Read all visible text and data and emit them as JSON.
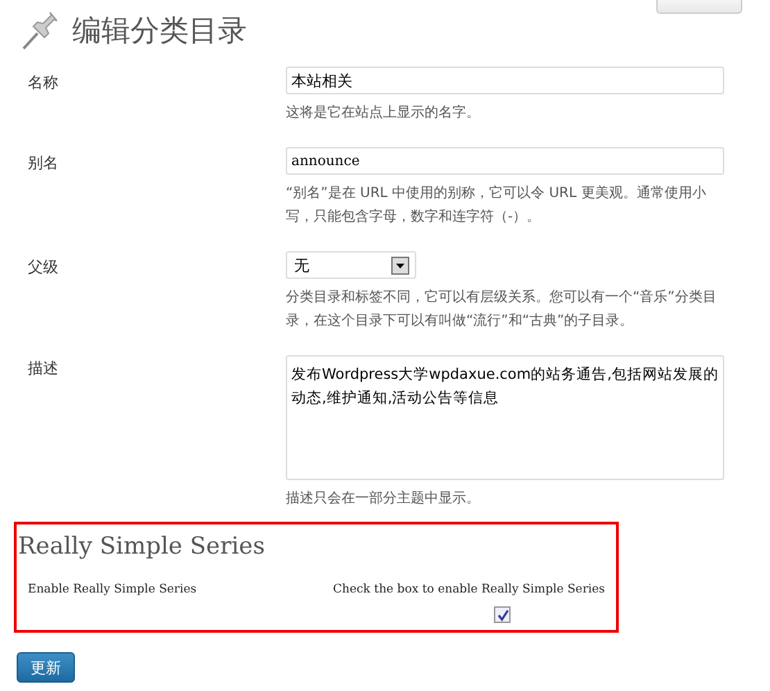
{
  "page_title": "编辑分类目录",
  "fields": [
    {
      "kind": "text",
      "label": "名称",
      "value": "本站相关",
      "hint": "这将是它在站点上显示的名字。"
    },
    {
      "kind": "slug",
      "label": "别名",
      "value": "announce",
      "hint": "“别名”是在 URL 中使用的别称，它可以令 URL 更美观。通常使用小写，只能包含字母，数字和连字符（-）。"
    },
    {
      "kind": "select",
      "label": "父级",
      "value": "无",
      "hint": "分类目录和标签不同，它可以有层级关系。您可以有一个“音乐”分类目录，在这个目录下可以有叫做“流行”和“古典”的子目录。"
    },
    {
      "kind": "textarea",
      "label": "描述",
      "value": "发布Wordpress大学wpdaxue.com的站务通告,包括网站发展的动态,维护通知,活动公告等信息",
      "hint": "描述只会在一部分主题中显示。"
    }
  ],
  "series_box": {
    "title": "Really Simple Series",
    "label": "Enable Really Simple Series",
    "hint": "Check the box to enable Really Simple Series",
    "checked": true
  },
  "submit_button": "更新"
}
